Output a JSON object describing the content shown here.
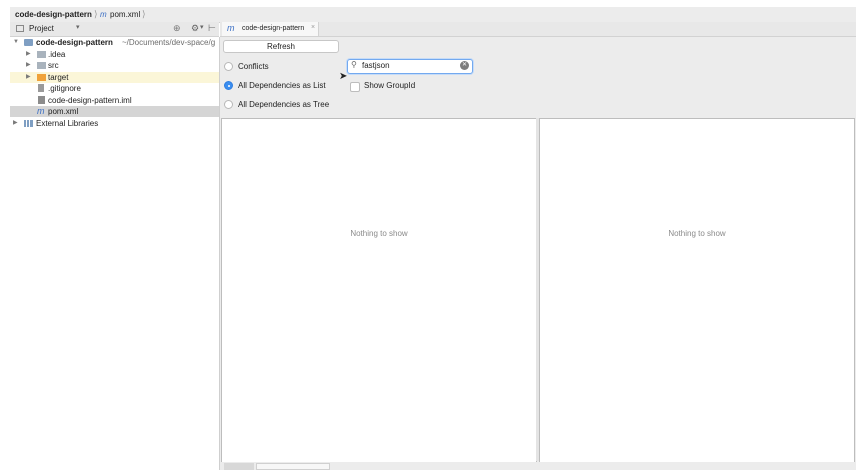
{
  "breadcrumb": {
    "project": "code-design-pattern",
    "file": "pom.xml"
  },
  "project_panel": {
    "title": "Project",
    "tree": [
      {
        "label": "code-design-pattern",
        "suffix": "~/Documents/dev-space/g",
        "type": "module"
      },
      {
        "label": ".idea",
        "type": "folder"
      },
      {
        "label": "src",
        "type": "folder"
      },
      {
        "label": "target",
        "type": "folder-excluded"
      },
      {
        "label": ".gitignore",
        "type": "file"
      },
      {
        "label": "code-design-pattern.iml",
        "type": "iml"
      },
      {
        "label": "pom.xml",
        "type": "maven",
        "selected": true
      },
      {
        "label": "External Libraries",
        "type": "libraries"
      }
    ]
  },
  "editor_tab": {
    "title": "code-design-pattern"
  },
  "dependency_analyzer": {
    "refresh_label": "Refresh",
    "options": [
      {
        "label": "Conflicts",
        "selected": false
      },
      {
        "label": "All Dependencies as List",
        "selected": true
      },
      {
        "label": "All Dependencies as Tree",
        "selected": false
      }
    ],
    "search_value": "fastjson",
    "show_groupid_label": "Show GroupId",
    "show_groupid_checked": false,
    "left_empty_text": "Nothing to show",
    "right_empty_text": "Nothing to show"
  },
  "colors": {
    "accent": "#3b8ef0",
    "selection": "#d5d5d5",
    "folder": "#a9b3bd",
    "excluded_folder": "#f0a23a"
  }
}
